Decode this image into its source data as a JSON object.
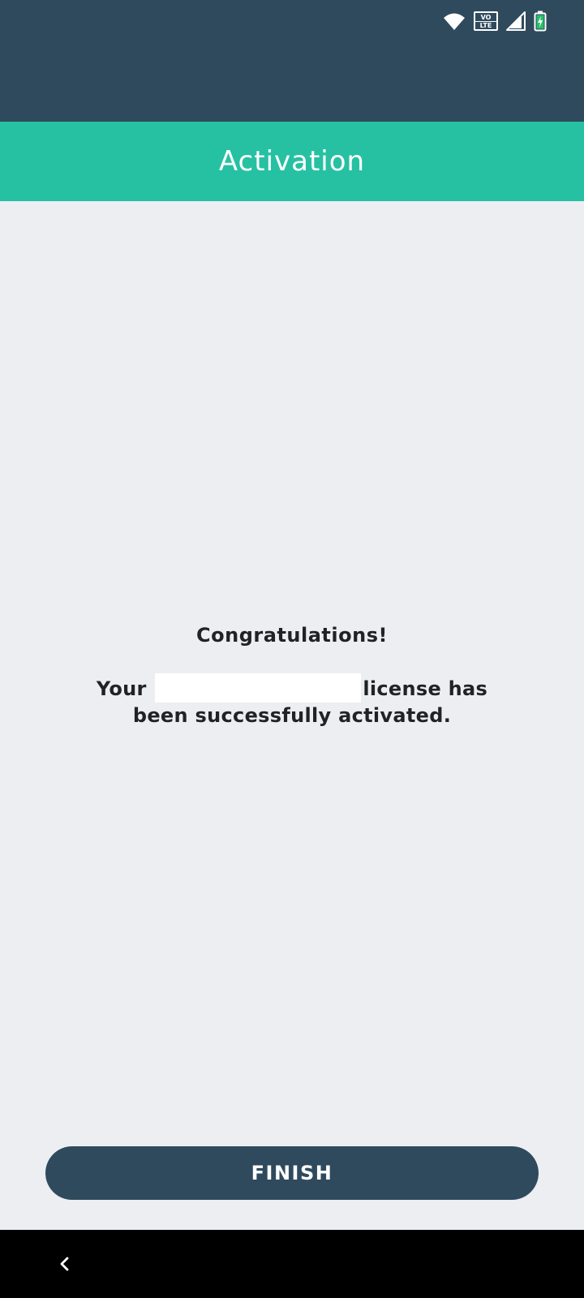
{
  "status_bar": {
    "icons": [
      "wifi-icon",
      "volte-icon",
      "signal-icon",
      "battery-charging-icon"
    ],
    "volte_top": "VO",
    "volte_bottom": "LTE",
    "background": "#2f4a5d"
  },
  "header": {
    "title": "Activation",
    "background": "#26c1a2"
  },
  "message": {
    "heading": "Congratulations!",
    "prefix": "Your",
    "suffix": "license has",
    "line2": "been successfully activated."
  },
  "actions": {
    "finish_label": "FINISH",
    "button_color": "#2f4a5d"
  },
  "nav_bar": {
    "back_icon": "chevron-left-icon"
  }
}
